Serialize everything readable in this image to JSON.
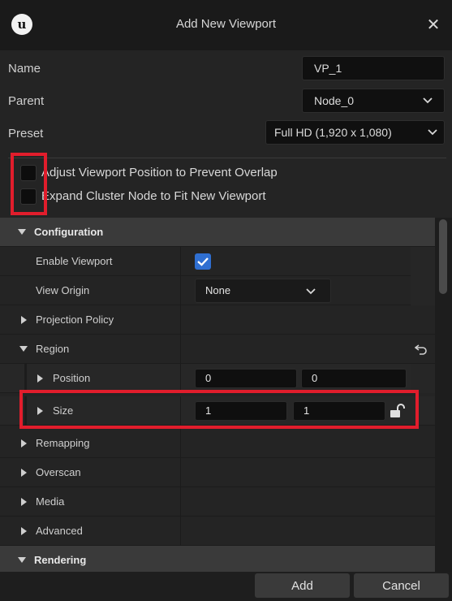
{
  "dialog": {
    "title": "Add New Viewport",
    "logo_letter": "u",
    "close_glyph": "✕"
  },
  "form": {
    "name_label": "Name",
    "name_value": "VP_1",
    "parent_label": "Parent",
    "parent_value": "Node_0",
    "preset_label": "Preset",
    "preset_value": "Full HD (1,920 x 1,080)",
    "adjust_label": "Adjust Viewport Position to Prevent Overlap",
    "adjust_checked": false,
    "expand_label": "Expand Cluster Node to Fit New Viewport",
    "expand_checked": false
  },
  "panel": {
    "configuration": "Configuration",
    "enable_viewport": "Enable Viewport",
    "enable_viewport_checked": true,
    "view_origin": "View Origin",
    "view_origin_value": "None",
    "projection_policy": "Projection Policy",
    "region": "Region",
    "position": "Position",
    "position_x": "0",
    "position_y": "0",
    "size": "Size",
    "size_x": "1",
    "size_y": "1",
    "remapping": "Remapping",
    "overscan": "Overscan",
    "media": "Media",
    "advanced": "Advanced",
    "rendering": "Rendering"
  },
  "buttons": {
    "add": "Add",
    "cancel": "Cancel"
  },
  "icons": {
    "check": "check-icon",
    "chevron": "chevron-down-icon",
    "reset": "reset-arrow-icon",
    "lock": "unlock-icon",
    "expand": "triangle-right-icon",
    "collapse": "triangle-down-icon"
  },
  "colors": {
    "accent": "#2f6fd1",
    "highlight": "#e11d2c"
  }
}
